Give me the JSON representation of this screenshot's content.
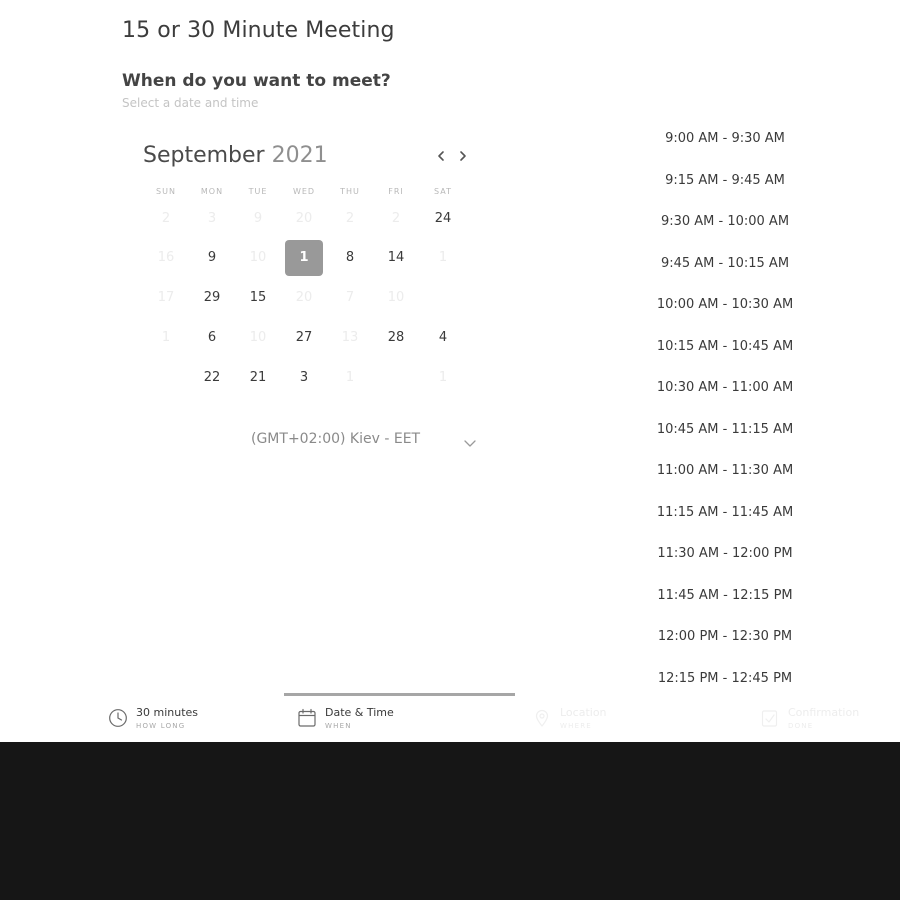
{
  "meeting": {
    "title": "15 or 30 Minute Meeting",
    "question": "When do you want to meet?",
    "subtext": "Select a date and time"
  },
  "calendar": {
    "month": "September",
    "year": "2021",
    "prev_icon": "chevron-left-icon",
    "next_icon": "chevron-right-icon",
    "weekdays": [
      "SUN",
      "MON",
      "TUE",
      "WED",
      "THU",
      "FRI",
      "SAT"
    ],
    "rows": [
      [
        {
          "label": "2",
          "state": "faded"
        },
        {
          "label": "3",
          "state": "faded"
        },
        {
          "label": "9",
          "state": "faded"
        },
        {
          "label": "20",
          "state": "faded"
        },
        {
          "label": "2",
          "state": "faded"
        },
        {
          "label": "2",
          "state": "faded"
        },
        {
          "label": "24",
          "state": "available"
        }
      ],
      [
        {
          "label": "16",
          "state": "faded"
        },
        {
          "label": "9",
          "state": "available"
        },
        {
          "label": "10",
          "state": "faded"
        },
        {
          "label": "1",
          "state": "selected"
        },
        {
          "label": "8",
          "state": "available"
        },
        {
          "label": "14",
          "state": "available"
        },
        {
          "label": "1",
          "state": "faded"
        }
      ],
      [
        {
          "label": "17",
          "state": "faded"
        },
        {
          "label": "29",
          "state": "available"
        },
        {
          "label": "15",
          "state": "available"
        },
        {
          "label": "20",
          "state": "faded"
        },
        {
          "label": "7",
          "state": "faded"
        },
        {
          "label": "10",
          "state": "faded"
        },
        {
          "label": "",
          "state": "faded"
        }
      ],
      [
        {
          "label": "1",
          "state": "faded"
        },
        {
          "label": "6",
          "state": "available"
        },
        {
          "label": "10",
          "state": "faded"
        },
        {
          "label": "27",
          "state": "available"
        },
        {
          "label": "13",
          "state": "faded"
        },
        {
          "label": "28",
          "state": "available"
        },
        {
          "label": "4",
          "state": "available"
        }
      ],
      [
        {
          "label": "",
          "state": "faded"
        },
        {
          "label": "22",
          "state": "available"
        },
        {
          "label": "21",
          "state": "available"
        },
        {
          "label": "3",
          "state": "available"
        },
        {
          "label": "1",
          "state": "faded"
        },
        {
          "label": "",
          "state": "faded"
        },
        {
          "label": "1",
          "state": "faded"
        }
      ]
    ]
  },
  "timezone": {
    "label": "(GMT+02:00) Kiev - EET",
    "icon": "chevron-down-icon"
  },
  "time_slots": [
    "9:00 AM - 9:30 AM",
    "9:15 AM - 9:45 AM",
    "9:30 AM - 10:00 AM",
    "9:45 AM - 10:15 AM",
    "10:00 AM - 10:30 AM",
    "10:15 AM - 10:45 AM",
    "10:30 AM - 11:00 AM",
    "10:45 AM - 11:15 AM",
    "11:00 AM - 11:30 AM",
    "11:15 AM - 11:45 AM",
    "11:30 AM - 12:00 PM",
    "11:45 AM - 12:15 PM",
    "12:00 PM - 12:30 PM",
    "12:15 PM - 12:45 PM"
  ],
  "steps": [
    {
      "label": "30 minutes",
      "sub": "HOW LONG",
      "icon": "clock-icon",
      "state": "done"
    },
    {
      "label": "Date & Time",
      "sub": "WHEN",
      "icon": "calendar-icon",
      "state": "active"
    },
    {
      "label": "Location",
      "sub": "WHERE",
      "icon": "location-pin-icon",
      "state": "faded"
    },
    {
      "label": "Confirmation",
      "sub": "DONE",
      "icon": "checkmark-icon",
      "state": "faded"
    }
  ],
  "colors": {
    "selected_day": "#999999",
    "background": "#ffffff",
    "dark_band": "#161616",
    "step_indicator": "#a6a6a6"
  }
}
